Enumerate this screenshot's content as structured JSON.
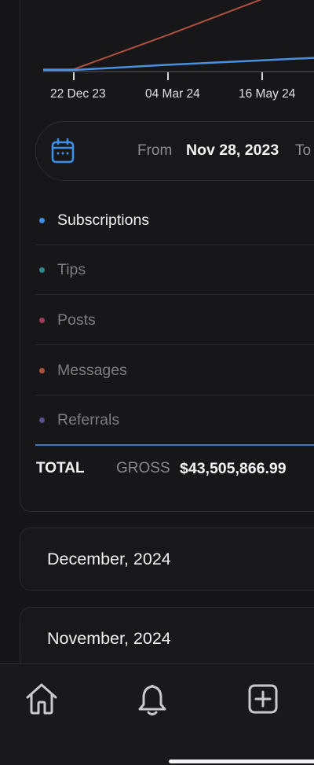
{
  "chart": {
    "x_ticks": [
      "22 Dec 23",
      "04 Mar 24",
      "16 May 24"
    ]
  },
  "chart_data": {
    "type": "line",
    "x": [
      "22 Dec 23",
      "04 Mar 24",
      "16 May 24"
    ],
    "series": [
      {
        "color": "#b0503f",
        "values": [
          1,
          24,
          48
        ]
      },
      {
        "color": "#4a90e0",
        "values": [
          0.5,
          4,
          7
        ]
      }
    ]
  },
  "date_range": {
    "from_label": "From",
    "from_value": "Nov 28, 2023",
    "to_label": "To"
  },
  "legend": [
    {
      "label": "Subscriptions",
      "color": "#3d8fe8",
      "active": true
    },
    {
      "label": "Tips",
      "color": "#2a8a8e",
      "active": false
    },
    {
      "label": "Posts",
      "color": "#a23a58",
      "active": false
    },
    {
      "label": "Messages",
      "color": "#b05040",
      "active": false
    },
    {
      "label": "Referrals",
      "color": "#5a4e8e",
      "active": false
    }
  ],
  "total": {
    "label": "TOTAL",
    "gross_label": "GROSS",
    "gross_value": "$43,505,866.99"
  },
  "months": [
    {
      "label": "December, 2024"
    },
    {
      "label": "November, 2024"
    }
  ],
  "nav": {
    "items": [
      {
        "icon": "home-icon"
      },
      {
        "icon": "bell-icon"
      },
      {
        "icon": "plus-square-icon"
      }
    ]
  }
}
